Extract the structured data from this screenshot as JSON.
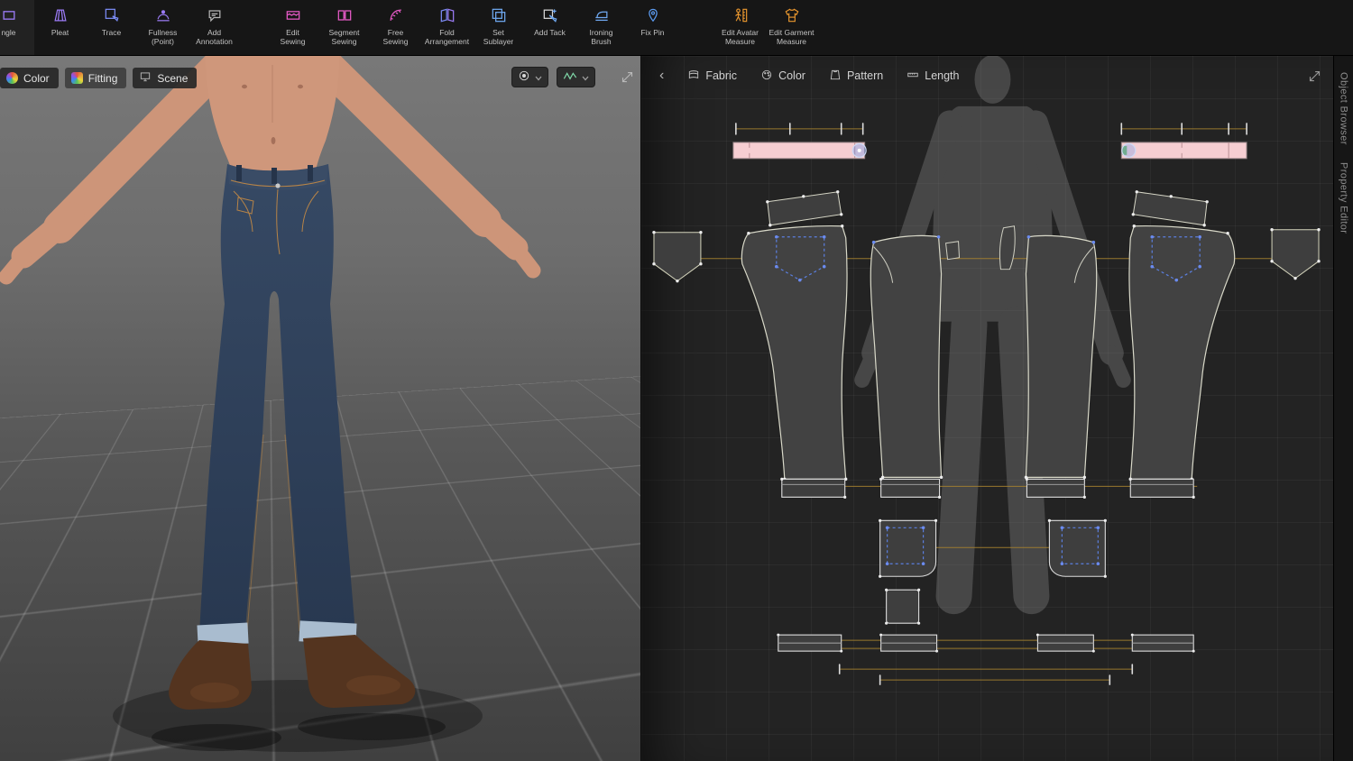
{
  "toolbar": {
    "items": [
      {
        "line1": "ngle",
        "line2": ""
      },
      {
        "line1": "Pleat",
        "line2": ""
      },
      {
        "line1": "Trace",
        "line2": ""
      },
      {
        "line1": "Fullness",
        "line2": "(Point)"
      },
      {
        "line1": "Add",
        "line2": "Annotation"
      },
      {
        "line1": "Edit",
        "line2": "Sewing"
      },
      {
        "line1": "Segment",
        "line2": "Sewing"
      },
      {
        "line1": "Free",
        "line2": "Sewing"
      },
      {
        "line1": "Fold",
        "line2": "Arrangement"
      },
      {
        "line1": "Set",
        "line2": "Sublayer"
      },
      {
        "line1": "Add Tack",
        "line2": ""
      },
      {
        "line1": "Ironing",
        "line2": "Brush"
      },
      {
        "line1": "Fix Pin",
        "line2": ""
      },
      {
        "line1": "Edit Avatar",
        "line2": "Measure"
      },
      {
        "line1": "Edit Garment",
        "line2": "Measure"
      }
    ]
  },
  "viewport": {
    "tabs": [
      {
        "label": "Color"
      },
      {
        "label": "Fitting"
      },
      {
        "label": "Scene"
      }
    ]
  },
  "pattern_panel": {
    "back": "‹",
    "tabs": [
      {
        "label": "Fabric"
      },
      {
        "label": "Color"
      },
      {
        "label": "Pattern"
      },
      {
        "label": "Length"
      }
    ]
  },
  "right_rail": {
    "object_browser": "Object Browser",
    "property_editor": "Property Editor"
  },
  "colors": {
    "waistband_pink": "#f6ced2",
    "sewing_line_orange": "#a5812f",
    "pattern_point_blue": "#6b8bf0",
    "accent_orange_icon": "#e8962e",
    "accent_magenta_icon": "#e85bc8",
    "accent_blue_icon": "#6fa8f0",
    "accent_purple_icon": "#9b7bf5"
  }
}
